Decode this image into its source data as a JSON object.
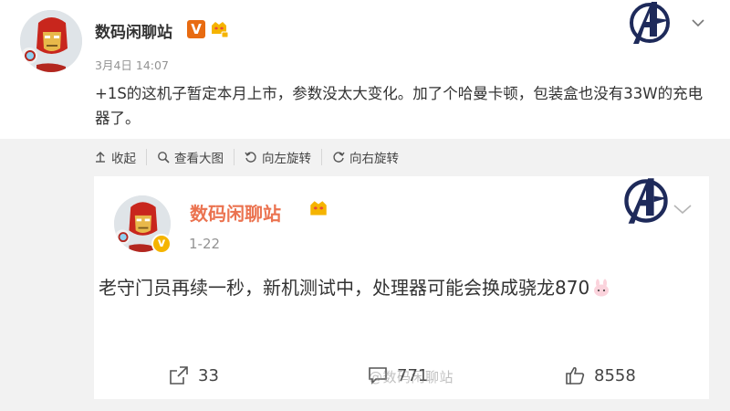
{
  "post": {
    "author": "数码闲聊站",
    "verified_badge": "V",
    "time": "3月4日 14:07",
    "content": "+1S的这机子暂定本月上市，参数没太大变化。加了个哈曼卡顿，包装盒也没有33W的充电器了。"
  },
  "toolbar": {
    "collapse": "收起",
    "view_large": "查看大图",
    "rotate_left": "向左旋转",
    "rotate_right": "向右旋转"
  },
  "quoted": {
    "author": "数码闲聊站",
    "verified_badge": "v",
    "time": "1-22",
    "content": "老守门员再续一秒，新机测试中，处理器可能会换成骁龙870",
    "shares": "33",
    "comments": "771",
    "likes": "8558",
    "watermark": "@数码闲聊站"
  },
  "icons": {
    "avatar": "iron-man-avatar",
    "brand": "avengers-logo",
    "menu": "chevron-down-icon"
  },
  "colors": {
    "author_orange": "#eb7350",
    "verified_orange": "#e86b11",
    "brand_navy": "#1e2a5a"
  }
}
